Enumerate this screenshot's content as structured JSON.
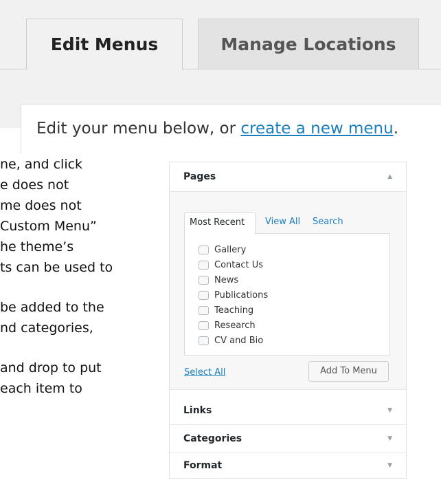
{
  "tabs": {
    "edit_menus": "Edit Menus",
    "manage_locations": "Manage Locations"
  },
  "notice": {
    "prefix": "Edit your menu below, or ",
    "link": "create a new menu",
    "suffix": "."
  },
  "body_text_lines": [
    "ne, and click",
    "e does not",
    "me does not",
    "Custom Menu”",
    "he theme’s",
    "ts can be used to",
    "",
    "be added to the",
    "nd categories,",
    "",
    "and drop to put",
    "each item to"
  ],
  "panel": {
    "pages": {
      "title": "Pages",
      "subtabs": [
        "Most Recent",
        "View All",
        "Search"
      ],
      "items": [
        "Gallery",
        "Contact Us",
        "News",
        "Publications",
        "Teaching",
        "Research",
        "CV and Bio"
      ],
      "select_all": "Select All",
      "add_button": "Add To Menu"
    },
    "links_title": "Links",
    "categories_title": "Categories",
    "format_title": "Format"
  }
}
